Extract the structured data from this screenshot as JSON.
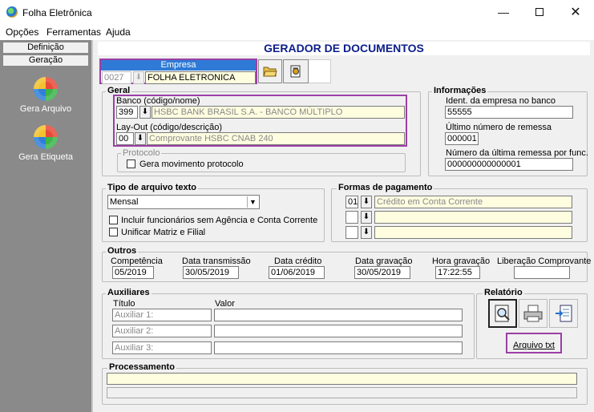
{
  "window": {
    "title": "Folha Eletrônica"
  },
  "menu": [
    "Opções",
    "Ferramentas",
    "Ajuda"
  ],
  "left_tabs": {
    "definicao": "Definição",
    "geracao": "Geração"
  },
  "nav": {
    "gera_arquivo": "Gera Arquivo",
    "gera_etiqueta": "Gera Etiqueta"
  },
  "header": "GERADOR DE DOCUMENTOS",
  "empresa": {
    "label": "Empresa",
    "code": "0027",
    "name": "FOLHA ELETRONICA"
  },
  "geral": {
    "title": "Geral",
    "banco_label": "Banco (código/nome)",
    "banco_code": "399",
    "banco_name": "HSBC BANK BRASIL S.A. - BANCO MÚLTIPLO",
    "layout_label": "Lay-Out (código/descrição)",
    "layout_code": "00",
    "layout_name": "Comprovante HSBC CNAB 240",
    "protocolo_title": "Protocolo",
    "gera_movimento": "Gera movimento protocolo"
  },
  "informacoes": {
    "title": "Informações",
    "ident_label": "Ident. da empresa no banco",
    "ident_value": "55555",
    "ultimo_label": "Último número de remessa",
    "ultimo_value": "000001",
    "numero_label": "Número da última remessa por func.",
    "numero_value": "000000000000001"
  },
  "tipo_arquivo": {
    "title": "Tipo de arquivo texto",
    "selected": "Mensal",
    "incluir": "Incluir funcionários sem Agência e Conta Corrente",
    "unificar": "Unificar Matriz e Filial"
  },
  "formas": {
    "title": "Formas de pagamento",
    "rows": [
      {
        "code": "01",
        "desc": "Crédito em Conta Corrente"
      },
      {
        "code": "",
        "desc": ""
      },
      {
        "code": "",
        "desc": ""
      }
    ]
  },
  "outros": {
    "title": "Outros",
    "competencia_label": "Competência",
    "competencia": "05/2019",
    "dt_transmissao_label": "Data transmissão",
    "dt_transmissao": "30/05/2019",
    "dt_credito_label": "Data crédito",
    "dt_credito": "01/06/2019",
    "dt_gravacao_label": "Data gravação",
    "dt_gravacao": "30/05/2019",
    "hr_gravacao_label": "Hora gravação",
    "hr_gravacao": "17:22:55",
    "liberacao_label": "Liberação Comprovante",
    "liberacao": ""
  },
  "auxiliares": {
    "title": "Auxiliares",
    "col_titulo": "Título",
    "col_valor": "Valor",
    "rows": [
      "Auxiliar 1:",
      "Auxiliar 2:",
      "Auxiliar 3:"
    ]
  },
  "relatorio": {
    "title": "Relatório",
    "arquivo_txt": "Arquivo txt"
  },
  "processamento": {
    "title": "Processamento"
  },
  "icons": [
    "folder-open-icon",
    "settings-doc-icon",
    "preview-icon",
    "printer-icon",
    "export-icon"
  ]
}
